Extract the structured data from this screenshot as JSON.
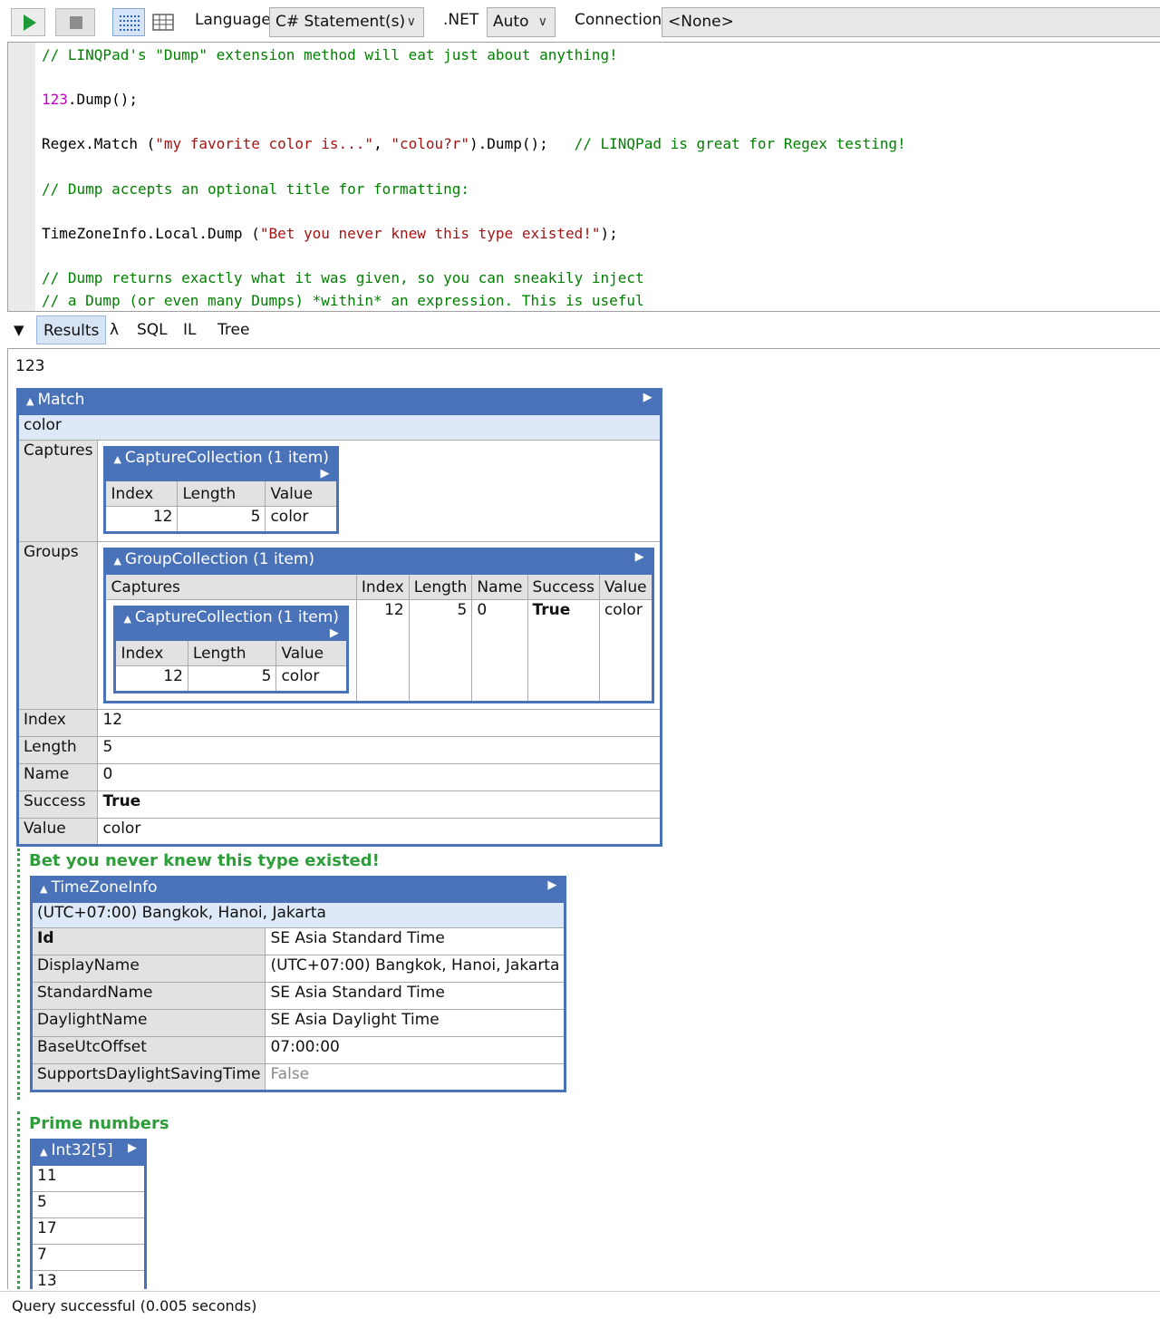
{
  "toolbar": {
    "language_label": "Language",
    "language_value": "C# Statement(s)",
    "dotnet_label": ".NET",
    "dotnet_value": "Auto",
    "connection_label": "Connection",
    "connection_value": "<None>"
  },
  "editor": {
    "lines": [
      "// LINQPad's \"Dump\" extension method will eat just about anything!",
      "",
      "123.Dump();",
      "",
      "Regex.Match (\"my favorite color is...\", \"colou?r\").Dump();   // LINQPad is great for Regex testing!",
      "",
      "// Dump accepts an optional title for formatting:",
      "",
      "TimeZoneInfo.Local.Dump (\"Bet you never knew this type existed!\");",
      "",
      "// Dump returns exactly what it was given, so you can sneakily inject",
      "// a Dump (or even many Dumps) *within* an expression. This is useful"
    ],
    "segments": {
      "l1": "// LINQPad's \"Dump\" extension method will eat just about anything!",
      "l3_num": "123",
      "l3_rest": ".Dump();",
      "l5_a": "Regex.Match (",
      "l5_s1": "\"my favorite color is...\"",
      "l5_b": ", ",
      "l5_s2": "\"colou?r\"",
      "l5_c": ").Dump();   ",
      "l5_cmt": "// LINQPad is great for Regex testing!",
      "l7": "// Dump accepts an optional title for formatting:",
      "l9_a": "TimeZoneInfo.Local.Dump (",
      "l9_s": "\"Bet you never knew this type existed!\"",
      "l9_b": ");",
      "l11": "// Dump returns exactly what it was given, so you can sneakily inject",
      "l12": "// a Dump (or even many Dumps) *within* an expression. This is useful"
    }
  },
  "tabs": {
    "collapse": "▼",
    "results": "Results",
    "lambda": "λ",
    "sql": "SQL",
    "il": "IL",
    "tree": "Tree"
  },
  "results": {
    "first_value": "123",
    "match": {
      "header": "Match",
      "summary": "color",
      "captures_key": "Captures",
      "captures": {
        "header": "CaptureCollection (1 item)",
        "columns": [
          "Index",
          "Length",
          "Value"
        ],
        "row": [
          "12",
          "5",
          "color"
        ]
      },
      "groups_key": "Groups",
      "groups": {
        "header": "GroupCollection (1 item)",
        "columns": [
          "Captures",
          "Index",
          "Length",
          "Name",
          "Success",
          "Value"
        ],
        "row": {
          "index": "12",
          "length": "5",
          "name": "0",
          "success": "True",
          "value": "color",
          "captures": {
            "header": "CaptureCollection (1 item)",
            "columns": [
              "Index",
              "Length",
              "Value"
            ],
            "row": [
              "12",
              "5",
              "color"
            ]
          }
        }
      },
      "props": [
        {
          "key": "Index",
          "value": "12"
        },
        {
          "key": "Length",
          "value": "5"
        },
        {
          "key": "Name",
          "value": "0"
        },
        {
          "key": "Success",
          "value": "True"
        },
        {
          "key": "Value",
          "value": "color"
        }
      ]
    },
    "timezone": {
      "title": "Bet you never knew this type existed!",
      "header": "TimeZoneInfo",
      "summary": "(UTC+07:00) Bangkok, Hanoi, Jakarta",
      "props": [
        {
          "key": "Id",
          "value": "SE Asia Standard Time"
        },
        {
          "key": "DisplayName",
          "value": "(UTC+07:00) Bangkok, Hanoi, Jakarta"
        },
        {
          "key": "StandardName",
          "value": "SE Asia Standard Time"
        },
        {
          "key": "DaylightName",
          "value": "SE Asia Daylight Time"
        },
        {
          "key": "BaseUtcOffset",
          "value": "07:00:00"
        },
        {
          "key": "SupportsDaylightSavingTime",
          "value": "False"
        }
      ]
    },
    "primes": {
      "title": "Prime numbers",
      "header": "Int32[5]",
      "values": [
        "11",
        "5",
        "17",
        "7",
        "13"
      ]
    }
  },
  "status": {
    "text": "Query successful  (0.005 seconds)"
  },
  "colors": {
    "header_blue": "#4a72b8",
    "title_green": "#2e9e3a",
    "comment_green": "#008000",
    "string_red": "#a31515",
    "number_magenta": "#c000c0"
  }
}
